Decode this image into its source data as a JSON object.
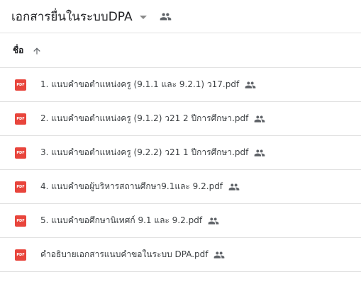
{
  "header": {
    "folder_title": "เอกสารยื่นในระบบDPA",
    "caret_icon": "dropdown-caret-icon",
    "shared_icon": "people-icon"
  },
  "list_header": {
    "name_label": "ชื่อ",
    "sort_icon": "arrow-up-icon"
  },
  "files": [
    {
      "name": "1. แนบคำขอตำแหน่งครู (9.1.1 และ 9.2.1) ว17.pdf",
      "type_badge": "PDF",
      "shared": true
    },
    {
      "name": "2. แนบคำขอตำแหน่งครู (9.1.2)  ว21 2 ปีการศึกษา.pdf",
      "type_badge": "PDF",
      "shared": true
    },
    {
      "name": "3. แนบคำขอตำแหน่งครู (9.2.2) ว21 1 ปีการศึกษา.pdf",
      "type_badge": "PDF",
      "shared": true
    },
    {
      "name": "4. แนบคำขอผู้บริหารสถานศึกษา9.1และ 9.2.pdf",
      "type_badge": "PDF",
      "shared": true
    },
    {
      "name": "5. แนบคำขอศึกษานิเทศก์ 9.1 และ 9.2.pdf",
      "type_badge": "PDF",
      "shared": true
    },
    {
      "name": "คำอธิบายเอกสารแนบคำขอในระบบ DPA.pdf",
      "type_badge": "PDF",
      "shared": true
    }
  ],
  "colors": {
    "pdf_red": "#e8453c",
    "icon_grey": "#5f6368",
    "divider": "#e0e0e0"
  }
}
